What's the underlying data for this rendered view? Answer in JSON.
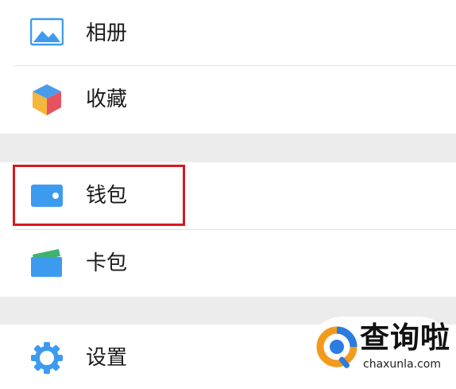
{
  "menu": {
    "items": [
      {
        "label": "相册",
        "icon": "photo-album-icon",
        "color": "#3d9bef"
      },
      {
        "label": "收藏",
        "icon": "favorites-cube-icon",
        "color": "#f5b63d"
      },
      {
        "label": "钱包",
        "icon": "wallet-icon",
        "color": "#3d9bef"
      },
      {
        "label": "卡包",
        "icon": "card-wallet-icon",
        "color": "#3d9bef"
      },
      {
        "label": "设置",
        "icon": "settings-gear-icon",
        "color": "#3d9bef"
      }
    ]
  },
  "highlight": {
    "target": "钱包",
    "color": "#d71920"
  },
  "watermark": {
    "title": "查询啦",
    "url": "chaxunla.com",
    "colors": {
      "orange": "#f39a1e",
      "blue": "#2b7ce0"
    }
  }
}
